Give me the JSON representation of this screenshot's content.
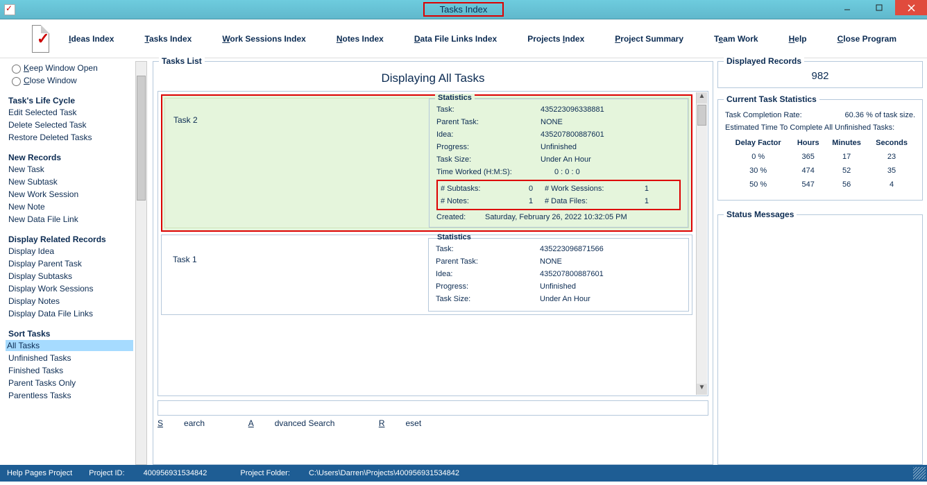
{
  "window": {
    "title": "Tasks Index"
  },
  "menubar": {
    "items": [
      {
        "pre": "",
        "u": "I",
        "post": "deas Index"
      },
      {
        "pre": "",
        "u": "T",
        "post": "asks Index"
      },
      {
        "pre": "",
        "u": "W",
        "post": "ork Sessions Index"
      },
      {
        "pre": "",
        "u": "N",
        "post": "otes Index"
      },
      {
        "pre": "",
        "u": "D",
        "post": "ata File Links Index"
      },
      {
        "pre": "Projects ",
        "u": "I",
        "post": "ndex"
      },
      {
        "pre": "",
        "u": "P",
        "post": "roject Summary"
      },
      {
        "pre": "T",
        "u": "e",
        "post": "am Work"
      },
      {
        "pre": "",
        "u": "H",
        "post": "elp"
      },
      {
        "pre": "",
        "u": "C",
        "post": "lose Program"
      }
    ]
  },
  "sidebar": {
    "radios": [
      {
        "u": "K",
        "rest": "eep Window Open"
      },
      {
        "u": "C",
        "rest": "lose Window"
      }
    ],
    "life_cycle": {
      "head": "Task's Life Cycle",
      "items": [
        "Edit Selected Task",
        "Delete Selected Task",
        "Restore Deleted Tasks"
      ]
    },
    "new_records": {
      "head": "New Records",
      "items": [
        "New Task",
        "New Subtask",
        "New Work Session",
        "New Note",
        "New Data File Link"
      ]
    },
    "display_related": {
      "head": "Display Related Records",
      "items": [
        "Display Idea",
        "Display Parent Task",
        "Display Subtasks",
        "Display Work Sessions",
        "Display Notes",
        "Display Data File Links"
      ]
    },
    "sort_tasks": {
      "head": "Sort Tasks",
      "items": [
        "All Tasks",
        "Unfinished Tasks",
        "Finished Tasks",
        "Parent Tasks Only",
        "Parentless Tasks"
      ],
      "selected_index": 0
    }
  },
  "tasks_list": {
    "legend": "Tasks List",
    "header": "Displaying All Tasks",
    "stats_legend": "Statistics",
    "labels": {
      "task": "Task:",
      "parent": "Parent Task:",
      "idea": "Idea:",
      "progress": "Progress:",
      "size": "Task Size:",
      "time_worked": "Time Worked (H:M:S):",
      "subtasks": "# Subtasks:",
      "work_sessions": "# Work Sessions:",
      "notes": "# Notes:",
      "data_files": "# Data Files:",
      "created": "Created:"
    },
    "tasks": [
      {
        "name": "Task 2",
        "task_id": "435223096338881",
        "parent": "NONE",
        "idea": "435207800887601",
        "progress": "Unfinished",
        "size": "Under An Hour",
        "time_worked": "0  :  0  :  0",
        "subtasks": "0",
        "work_sessions": "1",
        "notes": "1",
        "data_files": "1",
        "created": "Saturday, February 26, 2022   10:32:05 PM"
      },
      {
        "name": "Task 1",
        "task_id": "435223096871566",
        "parent": "NONE",
        "idea": "435207800887601",
        "progress": "Unfinished",
        "size": "Under An Hour"
      }
    ]
  },
  "search": {
    "search_u": "S",
    "search_rest": "earch",
    "adv_u": "A",
    "adv_rest": "dvanced Search",
    "reset_u": "R",
    "reset_rest": "eset"
  },
  "displayed_records": {
    "legend": "Displayed Records",
    "value": "982"
  },
  "current_stats": {
    "legend": "Current Task Statistics",
    "completion_label": "Task Completion Rate:",
    "completion_value": "60.36 % of task size.",
    "est_label": "Estimated Time To Complete All Unfinished Tasks:",
    "headers": [
      "Delay Factor",
      "Hours",
      "Minutes",
      "Seconds"
    ],
    "rows": [
      [
        "0 %",
        "365",
        "17",
        "23"
      ],
      [
        "30 %",
        "474",
        "52",
        "35"
      ],
      [
        "50 %",
        "547",
        "56",
        "4"
      ]
    ]
  },
  "status_messages": {
    "legend": "Status Messages"
  },
  "statusbar": {
    "project_name": "Help Pages Project",
    "project_id_label": "Project ID:",
    "project_id": "400956931534842",
    "project_folder_label": "Project Folder:",
    "project_folder": "C:\\Users\\Darren\\Projects\\400956931534842"
  }
}
